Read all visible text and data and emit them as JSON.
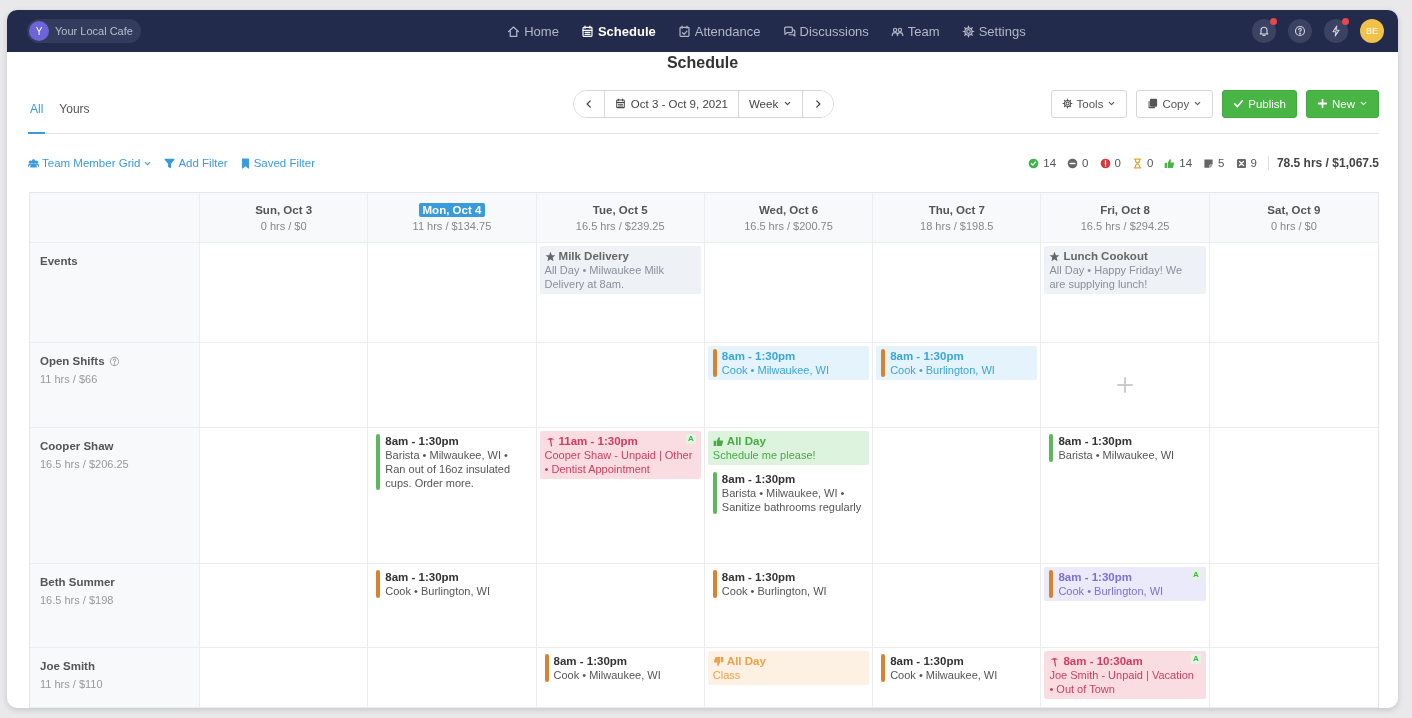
{
  "nav": {
    "workspace": {
      "initial": "Y",
      "name": "Your Local Cafe"
    },
    "items": [
      {
        "kind": "home",
        "label": "Home",
        "selected": false
      },
      {
        "kind": "calendar",
        "label": "Schedule",
        "selected": true
      },
      {
        "kind": "check-calendar",
        "label": "Attendance",
        "selected": false
      },
      {
        "kind": "chat",
        "label": "Discussions",
        "selected": false
      },
      {
        "kind": "team",
        "label": "Team",
        "selected": false
      },
      {
        "kind": "gear",
        "label": "Settings",
        "selected": false
      }
    ],
    "actions": [
      {
        "kind": "bell",
        "alert": true
      },
      {
        "kind": "help",
        "alert": false
      },
      {
        "kind": "bolt",
        "alert": true
      }
    ],
    "user": {
      "initials": "BE"
    }
  },
  "title": "Schedule",
  "tabs": [
    {
      "label": "All",
      "selected": true
    },
    {
      "label": "Yours",
      "selected": false
    }
  ],
  "date_nav": {
    "range": "Oct 3 - Oct 9, 2021",
    "view": "Week"
  },
  "buttons": [
    {
      "kind": "tools",
      "label": "Tools",
      "menu": true
    },
    {
      "kind": "copy",
      "label": "Copy",
      "menu": true
    },
    {
      "kind": "publish",
      "label": "Publish",
      "menu": false
    },
    {
      "kind": "new",
      "label": "New",
      "menu": true
    }
  ],
  "filters": [
    {
      "kind": "people",
      "label": "Team Member Grid",
      "menu": true
    },
    {
      "kind": "filter",
      "label": "Add Filter",
      "menu": false
    },
    {
      "kind": "bookmark",
      "label": "Saved Filter",
      "menu": false
    }
  ],
  "stats": [
    {
      "kind": "scheduled",
      "count": "14"
    },
    {
      "kind": "unscheduled",
      "count": "0"
    },
    {
      "kind": "conflict",
      "count": "0"
    },
    {
      "kind": "pending",
      "count": "0"
    },
    {
      "kind": "available",
      "count": "14"
    },
    {
      "kind": "notes",
      "count": "5"
    },
    {
      "kind": "unavailable",
      "count": "9"
    }
  ],
  "total": "78.5 hrs / $1,067.5",
  "days": [
    {
      "label": "Sun, Oct 3",
      "summary": "0 hrs / $0",
      "selected": false
    },
    {
      "label": "Mon, Oct 4",
      "summary": "11 hrs / $134.75",
      "selected": true
    },
    {
      "label": "Tue, Oct 5",
      "summary": "16.5 hrs / $239.25",
      "selected": false
    },
    {
      "label": "Wed, Oct 6",
      "summary": "16.5 hrs / $200.75",
      "selected": false
    },
    {
      "label": "Thu, Oct 7",
      "summary": "18 hrs / $198.5",
      "selected": false
    },
    {
      "label": "Fri, Oct 8",
      "summary": "16.5 hrs / $294.25",
      "selected": false
    },
    {
      "label": "Sat, Oct 9",
      "summary": "0 hrs / $0",
      "selected": false
    }
  ],
  "rows": [
    {
      "label": "Events",
      "help": false,
      "cells": [
        [],
        [],
        [
          {
            "kind": "event",
            "title": "Milk Delivery",
            "detail": "All Day • Milwaukee Milk Delivery at 8am."
          }
        ],
        [],
        [],
        [
          {
            "kind": "event",
            "title": "Lunch Cookout",
            "detail": "All Day • Happy Friday! We are supplying lunch!"
          }
        ],
        []
      ]
    },
    {
      "label": "Open Shifts",
      "help": true,
      "summary": "11 hrs / $66",
      "cells": [
        [],
        [],
        [],
        [
          {
            "kind": "open",
            "title": "8am - 1:30pm",
            "detail": "Cook • Milwaukee, WI",
            "color": "#d9822b"
          }
        ],
        [
          {
            "kind": "open",
            "title": "8am - 1:30pm",
            "detail": "Cook • Burlington, WI",
            "color": "#d9822b"
          }
        ],
        [
          {
            "kind": "add"
          }
        ],
        []
      ]
    },
    {
      "label": "Cooper Shaw",
      "help": false,
      "summary": "16.5 hrs / $206.25",
      "cells": [
        [],
        [
          {
            "kind": "shift",
            "title": "8am - 1:30pm",
            "detail": "Barista • Milwaukee, WI • Ran out of 16oz insulated cups. Order more.",
            "color": "#5cb85c"
          }
        ],
        [
          {
            "kind": "timeoff",
            "title": "11am - 1:30pm",
            "detail": "Cooper Shaw - Unpaid | Other • Dentist Appointment",
            "badge": "A"
          }
        ],
        [
          {
            "kind": "available",
            "title": "All Day",
            "detail": "Schedule me please!"
          },
          {
            "kind": "shift",
            "title": "8am - 1:30pm",
            "detail": "Barista • Milwaukee, WI • Sanitize bathrooms regularly",
            "color": "#5cb85c"
          }
        ],
        [],
        [
          {
            "kind": "shift",
            "title": "8am - 1:30pm",
            "detail": "Barista • Milwaukee, WI",
            "color": "#5cb85c"
          }
        ],
        []
      ]
    },
    {
      "label": "Beth Summer",
      "help": false,
      "summary": "16.5 hrs / $198",
      "cells": [
        [],
        [
          {
            "kind": "shift",
            "title": "8am - 1:30pm",
            "detail": "Cook • Burlington, WI",
            "color": "#d9822b"
          }
        ],
        [],
        [
          {
            "kind": "shift",
            "title": "8am - 1:30pm",
            "detail": "Cook • Burlington, WI",
            "color": "#d9822b"
          }
        ],
        [],
        [
          {
            "kind": "pending",
            "title": "8am - 1:30pm",
            "detail": "Cook • Burlington, WI",
            "color": "#d9822b",
            "badge": "A"
          }
        ],
        []
      ]
    },
    {
      "label": "Joe Smith",
      "help": false,
      "summary": "11 hrs / $110",
      "cells": [
        [],
        [],
        [
          {
            "kind": "shift",
            "title": "8am - 1:30pm",
            "detail": "Cook • Milwaukee, WI",
            "color": "#d9822b"
          }
        ],
        [
          {
            "kind": "unavailable",
            "title": "All Day",
            "detail": "Class"
          }
        ],
        [
          {
            "kind": "shift",
            "title": "8am - 1:30pm",
            "detail": "Cook • Milwaukee, WI",
            "color": "#d9822b"
          }
        ],
        [
          {
            "kind": "timeoff",
            "title": "8am - 10:30am",
            "detail": "Joe Smith - Unpaid | Vacation • Out of Town",
            "badge": "A"
          }
        ],
        []
      ]
    }
  ]
}
